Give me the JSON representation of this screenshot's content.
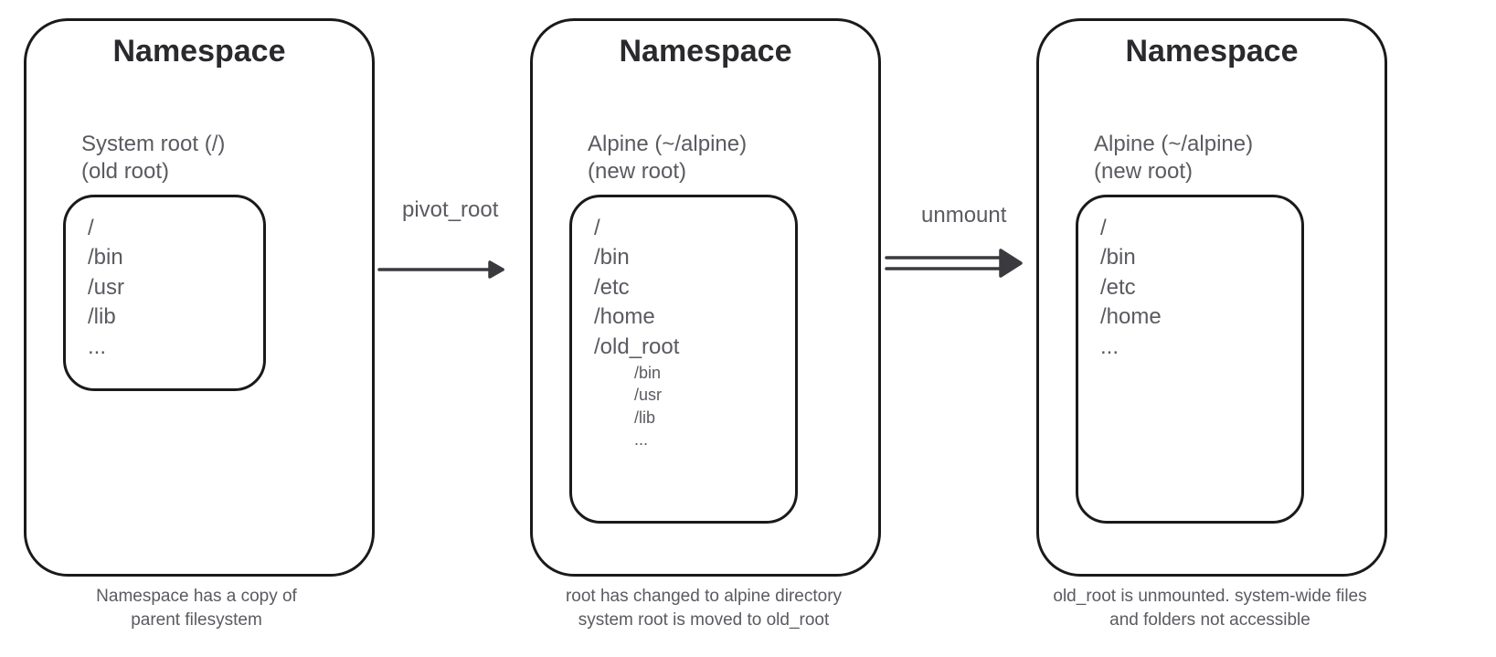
{
  "panels": [
    {
      "title": "Namespace",
      "root_label": "System root (/)\n(old root)",
      "fs": {
        "lines": [
          "/",
          "/bin",
          "/usr",
          "/lib",
          "..."
        ],
        "sub": []
      },
      "caption": "Namespace has a copy of\nparent filesystem"
    },
    {
      "title": "Namespace",
      "root_label": "Alpine (~/alpine)\n(new root)",
      "fs": {
        "lines": [
          "/",
          "/bin",
          "/etc",
          "/home",
          "/old_root"
        ],
        "sub": [
          "/bin",
          "/usr",
          "/lib",
          "..."
        ]
      },
      "caption": "root has changed to alpine directory\nsystem root is moved to old_root"
    },
    {
      "title": "Namespace",
      "root_label": "Alpine (~/alpine)\n(new root)",
      "fs": {
        "lines": [
          "/",
          "/bin",
          "/etc",
          "/home",
          "..."
        ],
        "sub": []
      },
      "caption": "old_root is unmounted. system-wide files\nand folders not accessible"
    }
  ],
  "arrows": [
    {
      "label": "pivot_root",
      "type": "single"
    },
    {
      "label": "unmount",
      "type": "double"
    }
  ]
}
